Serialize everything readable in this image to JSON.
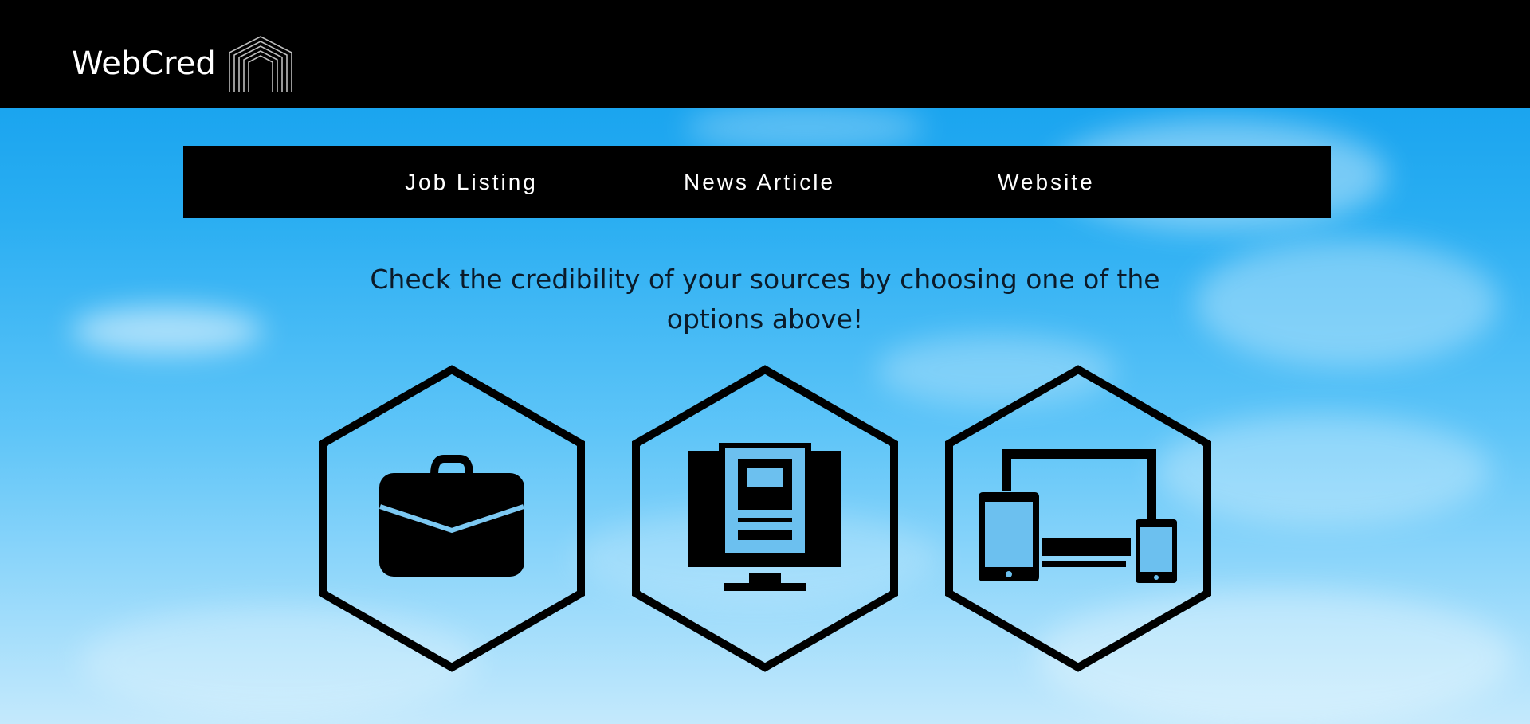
{
  "header": {
    "brand": "WebCred",
    "logo_icon": "arch-logo-icon",
    "background": "#000000"
  },
  "nav": {
    "items": [
      {
        "label": "Job Listing"
      },
      {
        "label": "News Article"
      },
      {
        "label": "Website"
      }
    ]
  },
  "main": {
    "tagline": "Check the credibility of your sources by choosing one of the options above!",
    "options": [
      {
        "icon": "briefcase-icon"
      },
      {
        "icon": "news-monitor-icon"
      },
      {
        "icon": "devices-icon"
      }
    ]
  },
  "colors": {
    "sky_top": "#0b9bec",
    "sky_bottom": "#c4e9fc",
    "icon": "#000000",
    "nav_text": "#ffffff"
  }
}
